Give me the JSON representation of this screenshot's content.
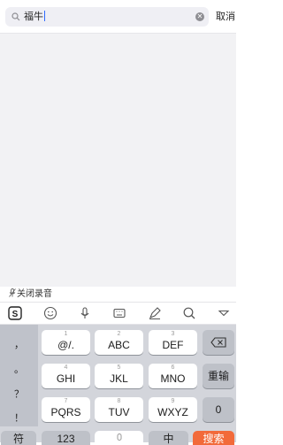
{
  "search": {
    "value": "福牛",
    "cancel_label": "取消"
  },
  "voice_toggle": {
    "label": "关闭录音"
  },
  "toolbar": {
    "tools": [
      "sogou-logo-icon",
      "emoji-icon",
      "microphone-icon",
      "keyboard-icon",
      "pen-icon",
      "search-icon",
      "collapse-icon"
    ],
    "logo_text": "S"
  },
  "keyboard": {
    "symbols": [
      "，",
      "。",
      "？",
      "！"
    ],
    "rows": [
      [
        {
          "num": "1",
          "label": "@/."
        },
        {
          "num": "2",
          "label": "ABC"
        },
        {
          "num": "3",
          "label": "DEF"
        }
      ],
      [
        {
          "num": "4",
          "label": "GHI"
        },
        {
          "num": "5",
          "label": "JKL"
        },
        {
          "num": "6",
          "label": "MNO"
        }
      ],
      [
        {
          "num": "7",
          "label": "PQRS"
        },
        {
          "num": "8",
          "label": "TUV"
        },
        {
          "num": "9",
          "label": "WXYZ"
        }
      ]
    ],
    "right_column": {
      "delete_icon": "backspace-icon",
      "retype_label": "重输",
      "zero_label": "0"
    },
    "bottom_row": {
      "symbol_label": "符",
      "number_label": "123",
      "space_icon": "microphone-icon",
      "lang_label": "中",
      "search_label": "搜索",
      "search_color": "#f26a3a"
    }
  }
}
